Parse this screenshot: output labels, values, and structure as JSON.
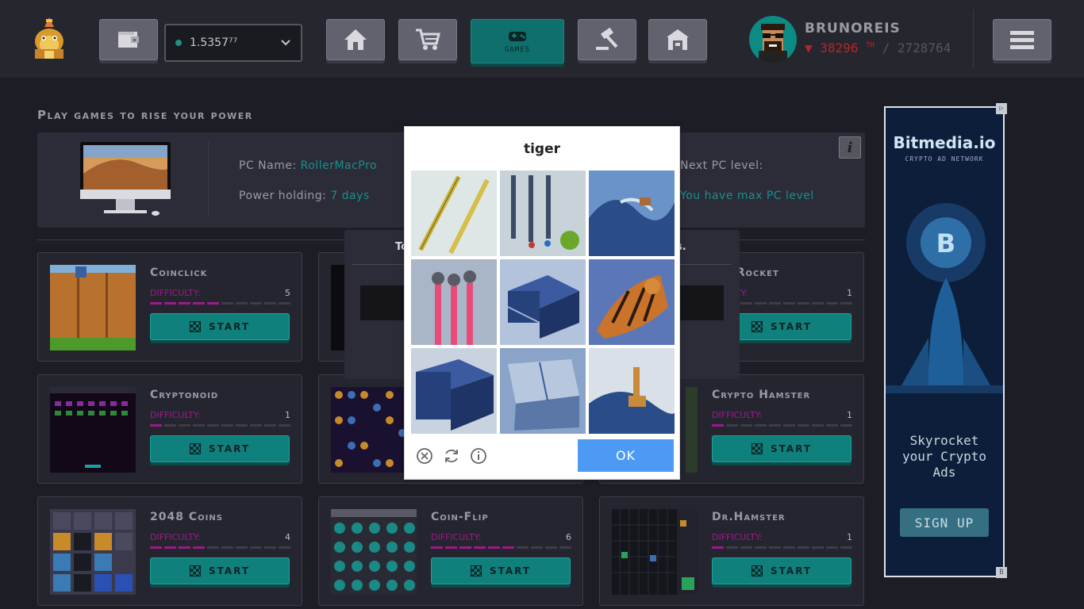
{
  "header": {
    "balance": "1.5357⁷⁷",
    "nav": [
      {
        "name": "wallet-icon"
      },
      {
        "name": "home-icon"
      },
      {
        "name": "cart-icon"
      },
      {
        "name": "gamepad-icon",
        "label": "GAMES",
        "active": true
      },
      {
        "name": "gavel-icon"
      },
      {
        "name": "bank-icon"
      }
    ],
    "username": "BRUNOREIS",
    "power_arrow": "▼",
    "power_value": "38296",
    "power_unit": "TH",
    "power_rank_sep": "/",
    "power_rank": "2728764",
    "menu_icon": "hamburger-icon"
  },
  "page": {
    "heading": "Play games to rise your power",
    "pc_name_label": "PC Name:",
    "pc_name": "RollerMacPro",
    "power_holding_label": "Power holding:",
    "power_holding": "7 days",
    "next_level_label": "Next PC level:",
    "next_level_value": "You have max PC level",
    "info_icon": "i"
  },
  "games": [
    {
      "title": "Coinclick",
      "difficulty_label": "DIFFICULTY:",
      "difficulty": "5",
      "level": 5,
      "start": "START"
    },
    {
      "title": "Flappy Rocket",
      "title_visible": "ppy Rocket",
      "difficulty_label": "DIFFICULTY:",
      "difficulty_visible": "FICULTY:",
      "difficulty": "1",
      "level": 1,
      "start": "START"
    },
    {
      "title": "Cryptonoid",
      "difficulty_label": "DIFFICULTY:",
      "difficulty": "1",
      "level": 1,
      "start": "START"
    },
    {
      "title": "Crypto Hamster",
      "difficulty_label": "DIFFICULTY:",
      "difficulty": "1",
      "level": 1,
      "start": "START"
    },
    {
      "title": "2048 Coins",
      "difficulty_label": "DIFFICULTY:",
      "difficulty": "4",
      "level": 4,
      "start": "START"
    },
    {
      "title": "Coin-Flip",
      "difficulty_label": "DIFFICULTY:",
      "difficulty": "6",
      "level": 6,
      "start": "START"
    },
    {
      "title": "Dr.Hamster",
      "difficulty_label": "DIFFICULTY:",
      "difficulty": "1",
      "level": 1,
      "start": "START"
    }
  ],
  "background_modal": {
    "left_text": "To",
    "right_text": "s."
  },
  "captcha": {
    "prompt": "tiger",
    "tiles": [
      "pens",
      "pens-with-sticker",
      "sea-wave",
      "brushes",
      "stacked-boxes",
      "tiger",
      "box",
      "box-closeup",
      "giraffe-wave"
    ],
    "ok_label": "OK",
    "icons": [
      "close-circle-icon",
      "refresh-icon",
      "info-circle-icon"
    ]
  },
  "ad": {
    "brand": "Bitmedia.io",
    "tag": "CRYPTO AD NETWORK",
    "tagline": "Skyrocket your Crypto Ads",
    "cta": "SIGN UP",
    "corner_top": "▷",
    "corner_bottom": "B"
  },
  "colors": {
    "accent": "#10807c",
    "power": "#b3262c",
    "difficulty": "#9d1a8a",
    "ok": "#4d9af5"
  }
}
